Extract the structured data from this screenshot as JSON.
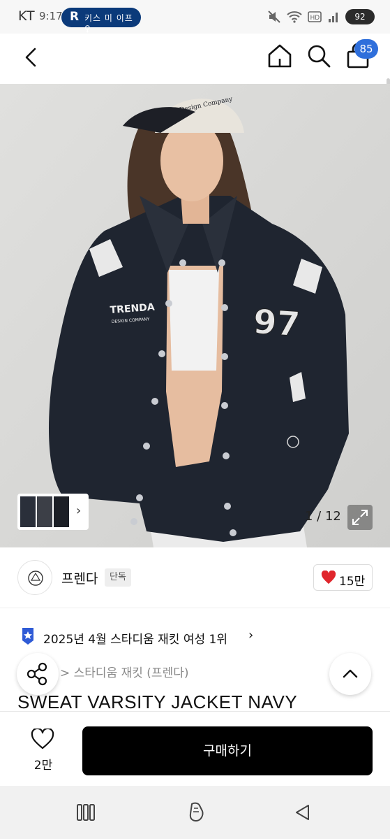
{
  "status_bar": {
    "carrier": "KT",
    "time": "9:17",
    "pill_letter": "R",
    "pill_text": "키스 미 이프 ♀",
    "battery": "92"
  },
  "nav": {
    "cart_count": "85",
    "icons": [
      "back-icon",
      "home-icon",
      "search-icon",
      "cart-icon"
    ]
  },
  "gallery": {
    "counter": "1 / 12",
    "thumb_chevron": "›",
    "print_brand": "TRENDA",
    "print_sub": "DESIGN COMPANY",
    "print_number": "97",
    "cap_text": "Design Company"
  },
  "brand": {
    "name": "프렌다",
    "tag": "단독",
    "likes": "15만"
  },
  "ranking": {
    "text": "2025년 4월 스타디움 재킷 여성 1위",
    "chevron": "›"
  },
  "category": {
    "path": "> 스타디움 재킷 (프렌다)"
  },
  "product": {
    "title": "SWEAT VARSITY JACKET NAVY"
  },
  "action_bar": {
    "wish_count": "2만",
    "buy_label": "구매하기"
  },
  "colors": {
    "accent_blue": "#2f6fdb",
    "heart_red": "#e0262c",
    "buy_button": "#000000",
    "jacket_navy": "#1f2530"
  }
}
